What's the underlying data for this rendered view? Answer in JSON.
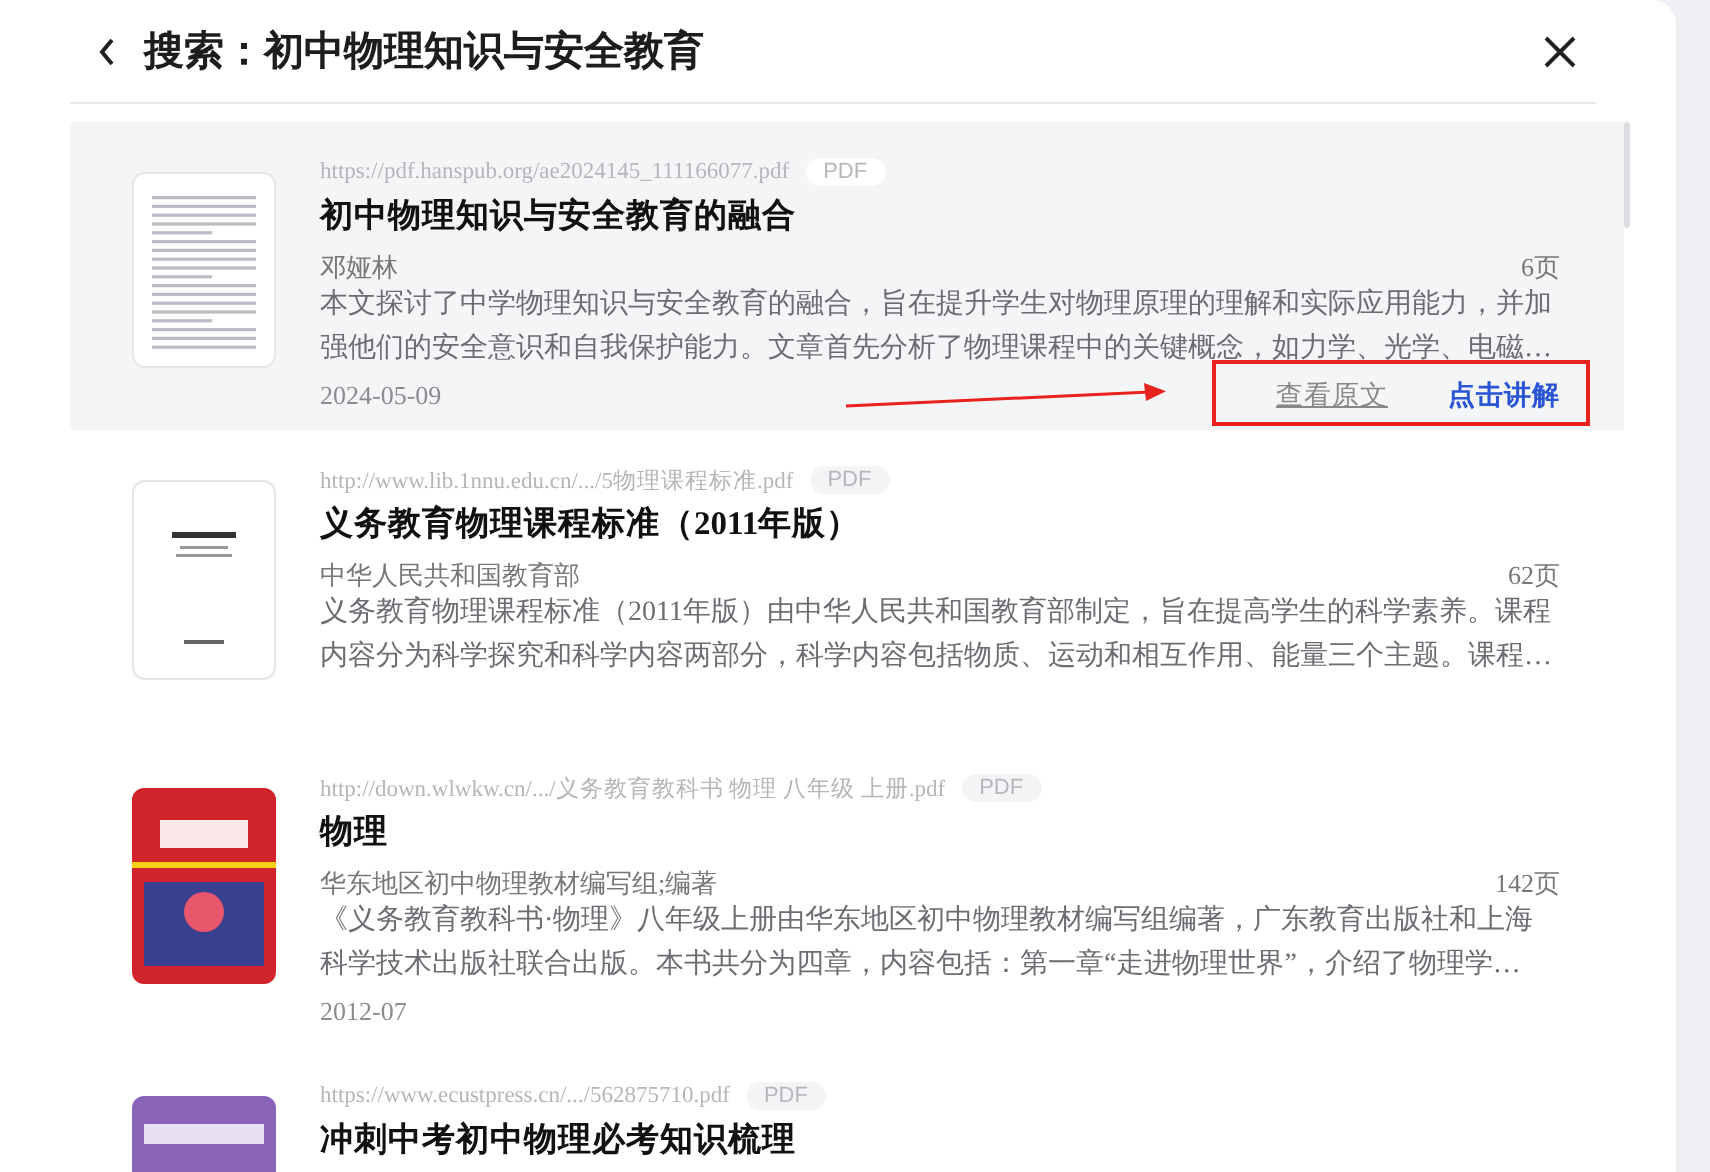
{
  "header": {
    "title": "搜索：初中物理知识与安全教育"
  },
  "results": [
    {
      "selected": true,
      "thumbnail": {
        "kind": "document"
      },
      "url": "https://pdf.hanspub.org/ae2024145_111166077.pdf",
      "file_type": "PDF",
      "title": "初中物理知识与安全教育的融合",
      "author": "邓娅林",
      "pages": "6页",
      "description": "本文探讨了中学物理知识与安全教育的融合，旨在提升学生对物理原理的理解和实际应用能力，并加强他们的安全意识和自我保护能力。文章首先分析了物理课程中的关键概念，如力学、光学、电磁…",
      "date": "2024-05-09",
      "actions": [
        {
          "label": "查看原文",
          "kind": "secondary"
        },
        {
          "label": "点击讲解",
          "kind": "primary"
        }
      ]
    },
    {
      "selected": false,
      "thumbnail": {
        "kind": "white-cover"
      },
      "url": "http://www.lib.1nnu.edu.cn/.../5物理课程标准.pdf",
      "file_type": "PDF",
      "title": "义务教育物理课程标准（2011年版）",
      "author": "中华人民共和国教育部",
      "pages": "62页",
      "description": "义务教育物理课程标准（2011年版）由中华人民共和国教育部制定，旨在提高学生的科学素养。课程内容分为科学探究和科学内容两部分，科学内容包括物质、运动和相互作用、能量三个主题。课程…"
    },
    {
      "selected": false,
      "thumbnail": {
        "kind": "red-cover"
      },
      "url": "http://down.wlwkw.cn/.../义务教育教科书 物理 八年级 上册.pdf",
      "file_type": "PDF",
      "title": "物理",
      "author": "华东地区初中物理教材编写组;编著",
      "pages": "142页",
      "description": "《义务教育教科书·物理》八年级上册由华东地区初中物理教材编写组编著，广东教育出版社和上海科学技术出版社联合出版。本书共分为四章，内容包括：第一章“走进物理世界”，介绍了物理学…",
      "date": "2012-07"
    },
    {
      "selected": false,
      "thumbnail": {
        "kind": "purple-cover"
      },
      "url": "https://www.ecustpress.cn/.../562875710.pdf",
      "file_type": "PDF",
      "title": "冲刺中考初中物理必考知识梳理"
    }
  ]
}
